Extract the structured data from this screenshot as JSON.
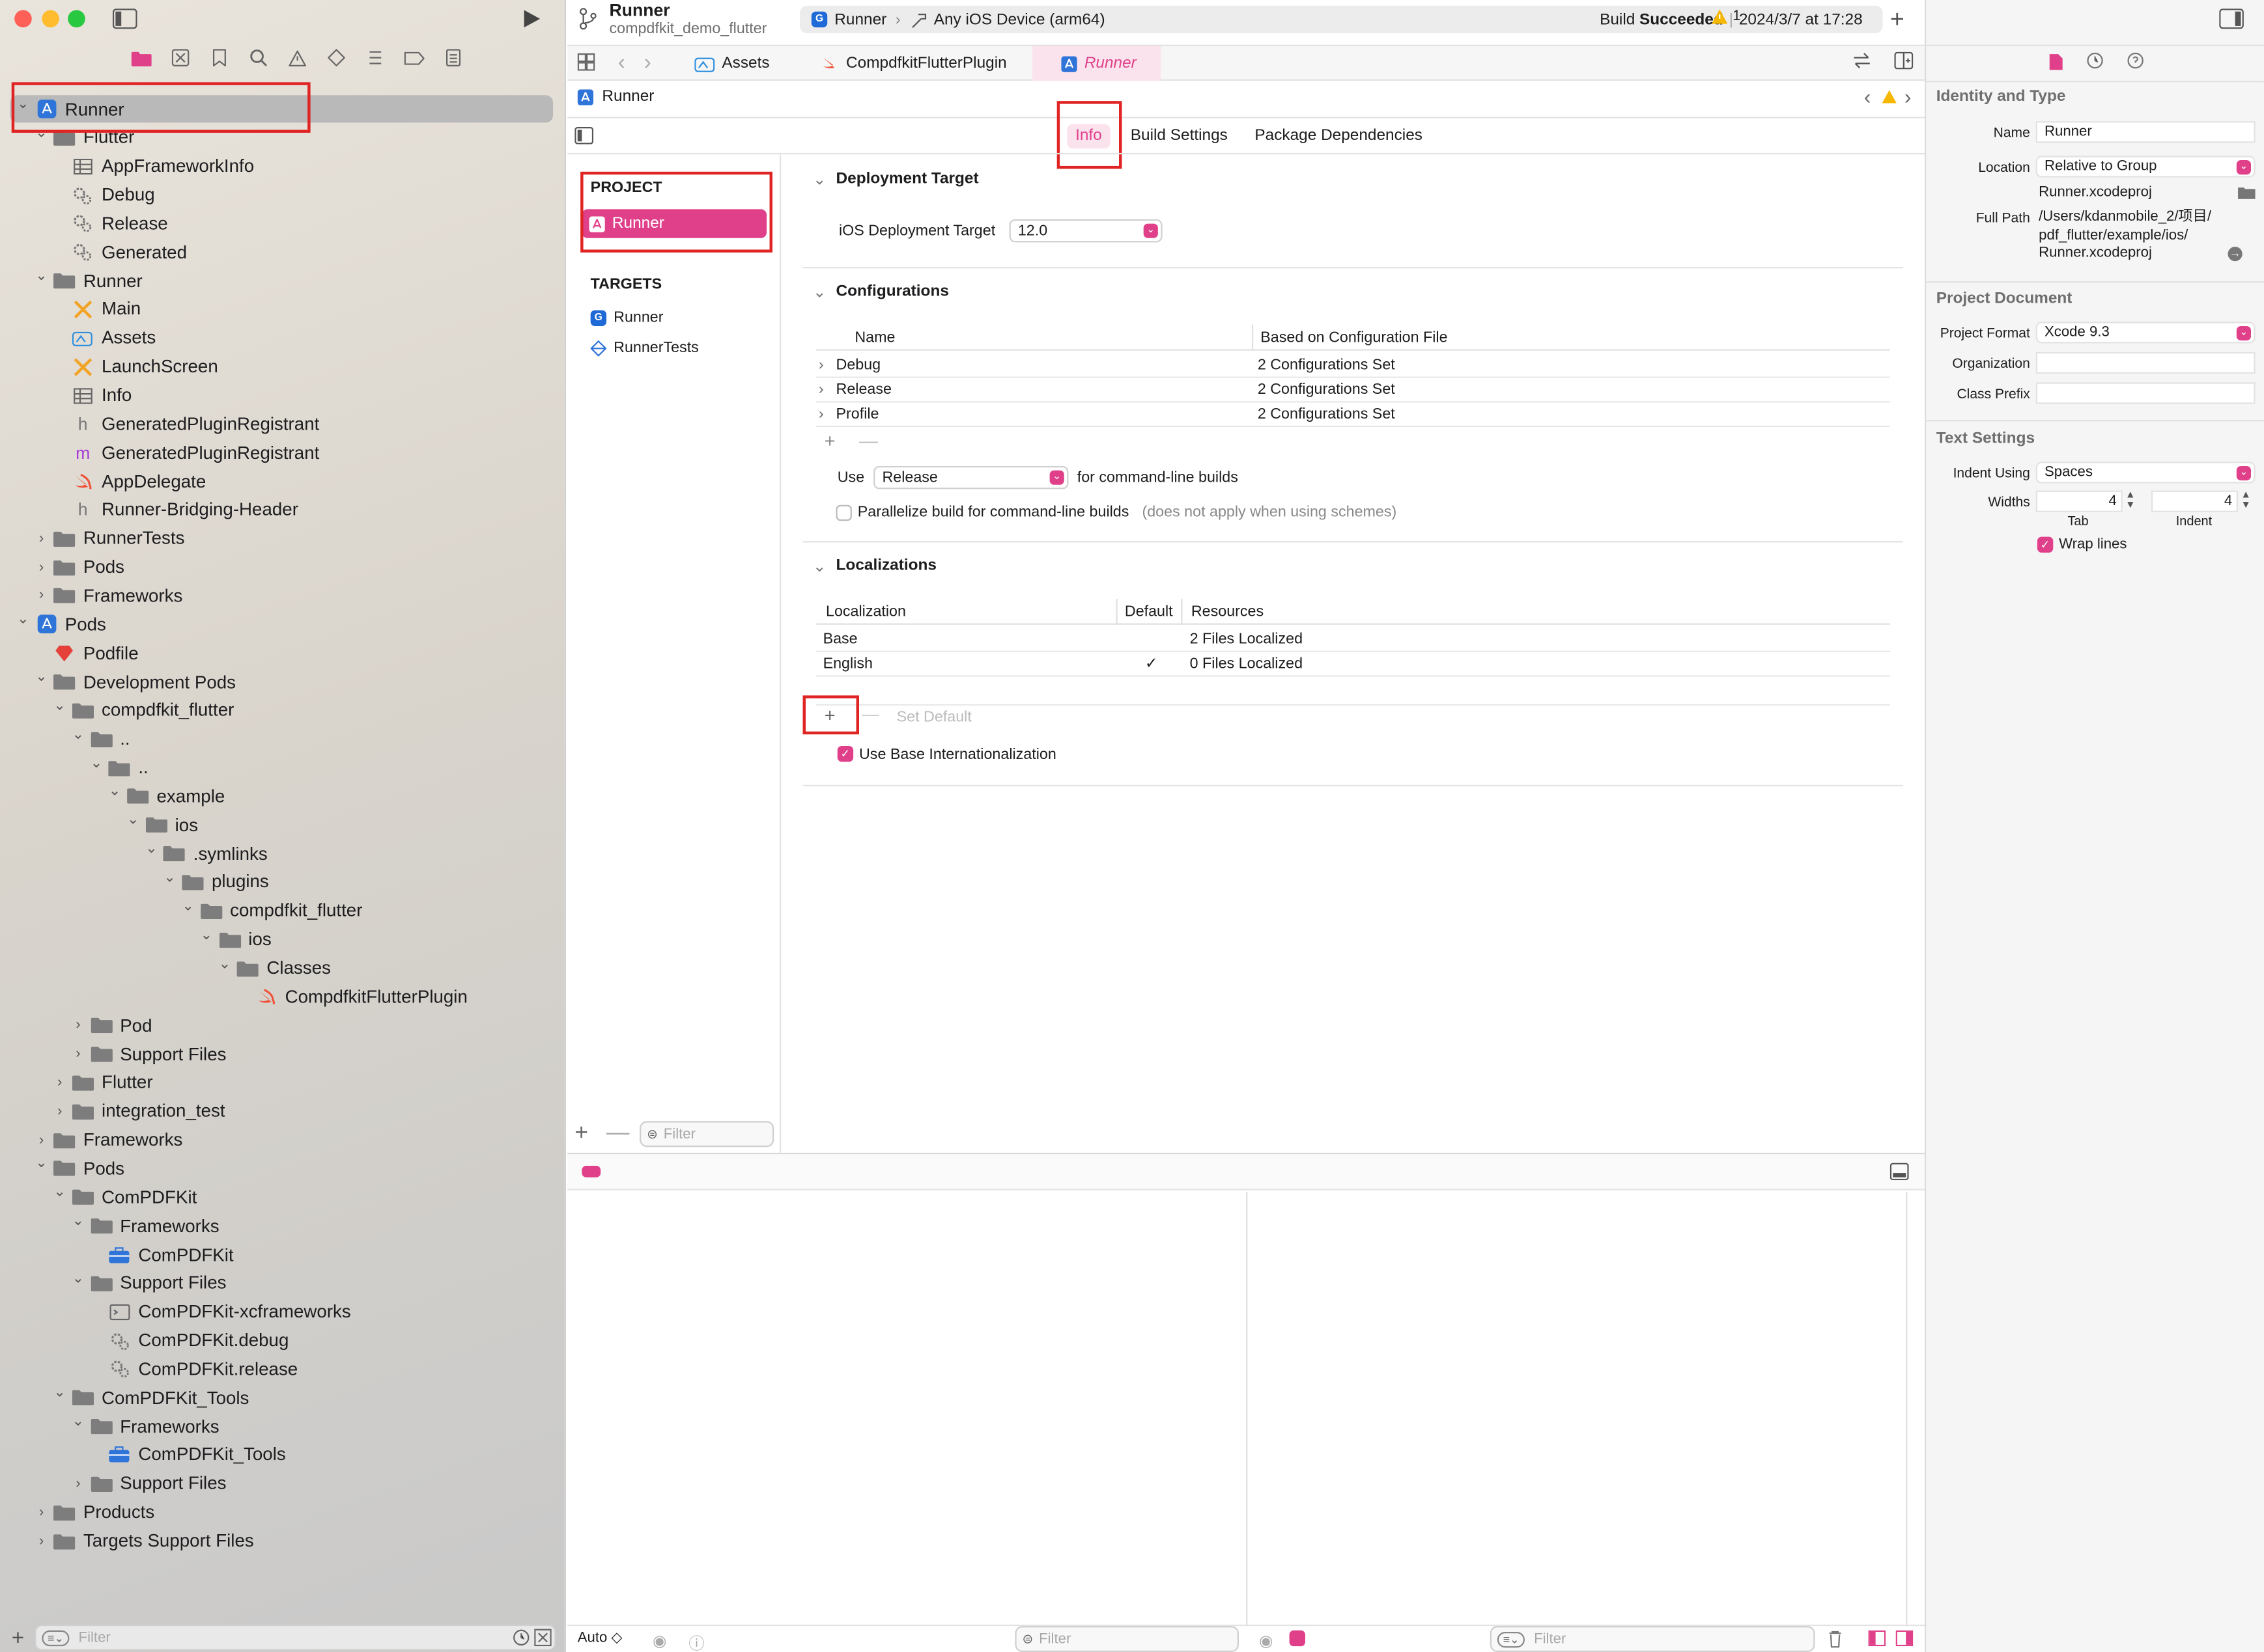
{
  "window": {
    "traffic": [
      "#fe5f57",
      "#febc2e",
      "#28c840"
    ]
  },
  "toolbar": {
    "scheme_title": "Runner",
    "scheme_subtitle": "compdfkit_demo_flutter",
    "run_target_scheme": "Runner",
    "run_target_device": "Any iOS Device (arm64)",
    "status_prefix": "Build",
    "status_bold": "Succeeded",
    "status_time": "2024/3/7 at 17:28",
    "warning_count": "1"
  },
  "navigator": {
    "filter_placeholder": "Filter",
    "tree": [
      {
        "label": "Runner",
        "indent": 0,
        "chev": "open",
        "icon": "app-icon",
        "selected": true
      },
      {
        "label": "Flutter",
        "indent": 1,
        "chev": "open",
        "icon": "folder-icon"
      },
      {
        "label": "AppFrameworkInfo",
        "indent": 2,
        "chev": "",
        "icon": "table-icon"
      },
      {
        "label": "Debug",
        "indent": 2,
        "chev": "",
        "icon": "gears-icon"
      },
      {
        "label": "Release",
        "indent": 2,
        "chev": "",
        "icon": "gears-icon"
      },
      {
        "label": "Generated",
        "indent": 2,
        "chev": "",
        "icon": "gears-icon"
      },
      {
        "label": "Runner",
        "indent": 1,
        "chev": "open",
        "icon": "folder-icon"
      },
      {
        "label": "Main",
        "indent": 2,
        "chev": "",
        "icon": "storyboard-icon"
      },
      {
        "label": "Assets",
        "indent": 2,
        "chev": "",
        "icon": "assets-icon"
      },
      {
        "label": "LaunchScreen",
        "indent": 2,
        "chev": "",
        "icon": "storyboard-icon"
      },
      {
        "label": "Info",
        "indent": 2,
        "chev": "",
        "icon": "table-icon"
      },
      {
        "label": "GeneratedPluginRegistrant",
        "indent": 2,
        "chev": "",
        "icon": "header-icon"
      },
      {
        "label": "GeneratedPluginRegistrant",
        "indent": 2,
        "chev": "",
        "icon": "objc-icon"
      },
      {
        "label": "AppDelegate",
        "indent": 2,
        "chev": "",
        "icon": "swift-icon"
      },
      {
        "label": "Runner-Bridging-Header",
        "indent": 2,
        "chev": "",
        "icon": "header-icon"
      },
      {
        "label": "RunnerTests",
        "indent": 1,
        "chev": "closed",
        "icon": "folder-icon"
      },
      {
        "label": "Pods",
        "indent": 1,
        "chev": "closed",
        "icon": "folder-icon"
      },
      {
        "label": "Frameworks",
        "indent": 1,
        "chev": "closed",
        "icon": "folder-icon"
      },
      {
        "label": "Pods",
        "indent": 0,
        "chev": "open",
        "icon": "app-icon"
      },
      {
        "label": "Podfile",
        "indent": 1,
        "chev": "",
        "icon": "ruby-icon"
      },
      {
        "label": "Development Pods",
        "indent": 1,
        "chev": "open",
        "icon": "folder-icon"
      },
      {
        "label": "compdfkit_flutter",
        "indent": 2,
        "chev": "open",
        "icon": "folder-icon"
      },
      {
        "label": "..",
        "indent": 3,
        "chev": "open",
        "icon": "folder-icon"
      },
      {
        "label": "..",
        "indent": 4,
        "chev": "open",
        "icon": "folder-icon"
      },
      {
        "label": "example",
        "indent": 5,
        "chev": "open",
        "icon": "folder-icon"
      },
      {
        "label": "ios",
        "indent": 6,
        "chev": "open",
        "icon": "folder-icon"
      },
      {
        "label": ".symlinks",
        "indent": 7,
        "chev": "open",
        "icon": "folder-icon"
      },
      {
        "label": "plugins",
        "indent": 8,
        "chev": "open",
        "icon": "folder-icon"
      },
      {
        "label": "compdfkit_flutter",
        "indent": 9,
        "chev": "open",
        "icon": "folder-icon"
      },
      {
        "label": "ios",
        "indent": 10,
        "chev": "open",
        "icon": "folder-icon"
      },
      {
        "label": "Classes",
        "indent": 11,
        "chev": "open",
        "icon": "folder-icon"
      },
      {
        "label": "CompdfkitFlutterPlugin",
        "indent": 12,
        "chev": "",
        "icon": "swift-icon"
      },
      {
        "label": "Pod",
        "indent": 3,
        "chev": "closed",
        "icon": "folder-icon"
      },
      {
        "label": "Support Files",
        "indent": 3,
        "chev": "closed",
        "icon": "folder-icon"
      },
      {
        "label": "Flutter",
        "indent": 2,
        "chev": "closed",
        "icon": "folder-icon"
      },
      {
        "label": "integration_test",
        "indent": 2,
        "chev": "closed",
        "icon": "folder-icon"
      },
      {
        "label": "Frameworks",
        "indent": 1,
        "chev": "closed",
        "icon": "folder-icon"
      },
      {
        "label": "Pods",
        "indent": 1,
        "chev": "open",
        "icon": "folder-icon"
      },
      {
        "label": "ComPDFKit",
        "indent": 2,
        "chev": "open",
        "icon": "folder-icon"
      },
      {
        "label": "Frameworks",
        "indent": 3,
        "chev": "open",
        "icon": "folder-icon"
      },
      {
        "label": "ComPDFKit",
        "indent": 4,
        "chev": "",
        "icon": "framework-icon"
      },
      {
        "label": "Support Files",
        "indent": 3,
        "chev": "open",
        "icon": "folder-icon"
      },
      {
        "label": "ComPDFKit-xcframeworks",
        "indent": 4,
        "chev": "",
        "icon": "script-icon"
      },
      {
        "label": "ComPDFKit.debug",
        "indent": 4,
        "chev": "",
        "icon": "gears-icon"
      },
      {
        "label": "ComPDFKit.release",
        "indent": 4,
        "chev": "",
        "icon": "gears-icon"
      },
      {
        "label": "ComPDFKit_Tools",
        "indent": 2,
        "chev": "open",
        "icon": "folder-icon"
      },
      {
        "label": "Frameworks",
        "indent": 3,
        "chev": "open",
        "icon": "folder-icon"
      },
      {
        "label": "ComPDFKit_Tools",
        "indent": 4,
        "chev": "",
        "icon": "framework-icon"
      },
      {
        "label": "Support Files",
        "indent": 3,
        "chev": "closed",
        "icon": "folder-icon"
      },
      {
        "label": "Products",
        "indent": 1,
        "chev": "closed",
        "icon": "folder-icon"
      },
      {
        "label": "Targets Support Files",
        "indent": 1,
        "chev": "closed",
        "icon": "folder-icon"
      }
    ]
  },
  "tabs": [
    {
      "label": "Assets",
      "icon": "assets-icon"
    },
    {
      "label": "CompdfkitFlutterPlugin",
      "icon": "swift-icon"
    },
    {
      "label": "Runner",
      "icon": "app-icon",
      "active": true
    }
  ],
  "jumpbar": {
    "label": "Runner"
  },
  "segments": {
    "info": "Info",
    "build_settings": "Build Settings",
    "package_deps": "Package Dependencies"
  },
  "project_list": {
    "project_header": "PROJECT",
    "project_item": "Runner",
    "targets_header": "TARGETS",
    "targets": [
      "Runner",
      "RunnerTests"
    ],
    "filter_placeholder": "Filter"
  },
  "deployment": {
    "title": "Deployment Target",
    "label": "iOS Deployment Target",
    "value": "12.0"
  },
  "configurations": {
    "title": "Configurations",
    "col_name": "Name",
    "col_based": "Based on Configuration File",
    "rows": [
      {
        "name": "Debug",
        "based": "2 Configurations Set"
      },
      {
        "name": "Release",
        "based": "2 Configurations Set"
      },
      {
        "name": "Profile",
        "based": "2 Configurations Set"
      }
    ],
    "use_label": "Use",
    "use_value": "Release",
    "use_suffix": "for command-line builds",
    "parallelize_label": "Parallelize build for command-line builds",
    "parallelize_note": "(does not apply when using schemes)"
  },
  "localizations": {
    "title": "Localizations",
    "col_loc": "Localization",
    "col_default": "Default",
    "col_resources": "Resources",
    "rows": [
      {
        "loc": "Base",
        "default": "",
        "resources": "2 Files Localized"
      },
      {
        "loc": "English",
        "default": "✓",
        "resources": "0 Files Localized"
      }
    ],
    "set_default": "Set Default",
    "base_intl": "Use Base Internationalization"
  },
  "debug_area": {
    "auto_label": "Auto ◇",
    "filter_left": "Filter",
    "filter_right": "Filter"
  },
  "inspector": {
    "identity_title": "Identity and Type",
    "name_label": "Name",
    "name_value": "Runner",
    "location_label": "Location",
    "location_value": "Relative to Group",
    "location_file": "Runner.xcodeproj",
    "fullpath_label": "Full Path",
    "fullpath_lines": [
      "/Users/kdanmobile_2/项目/",
      "pdf_flutter/example/ios/",
      "Runner.xcodeproj"
    ],
    "projdoc_title": "Project Document",
    "format_label": "Project Format",
    "format_value": "Xcode 9.3",
    "org_label": "Organization",
    "class_prefix_label": "Class Prefix",
    "text_title": "Text Settings",
    "indent_label": "Indent Using",
    "indent_value": "Spaces",
    "widths_label": "Widths",
    "tab_value": "4",
    "indent_width_value": "4",
    "tab_caption": "Tab",
    "indent_caption": "Indent",
    "wrap_label": "Wrap lines"
  },
  "colors": {
    "accent": "#e0408a",
    "highlight": "#e02323",
    "nav_folder": "#7d7d7d"
  }
}
